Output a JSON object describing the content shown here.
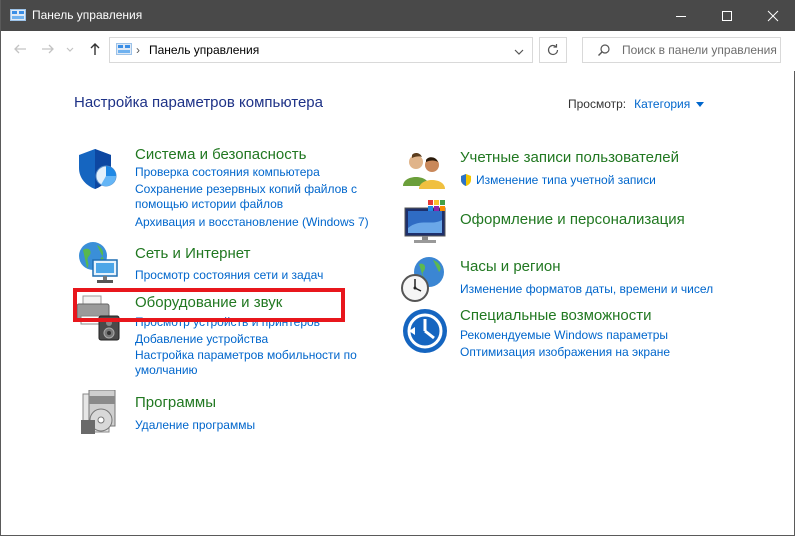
{
  "window": {
    "title": "Панель управления"
  },
  "address": {
    "path": "Панель управления"
  },
  "search": {
    "placeholder": "Поиск в панели управления"
  },
  "main": {
    "heading": "Настройка параметров компьютера",
    "view_label": "Просмотр:",
    "view_value": "Категория"
  },
  "categories": {
    "system": {
      "title": "Система и безопасность",
      "links": [
        "Проверка состояния компьютера",
        "Сохранение резервных копий файлов с",
        "помощью истории файлов",
        "Архивация и восстановление (Windows 7)"
      ]
    },
    "network": {
      "title": "Сеть и Интернет",
      "links": [
        "Просмотр состояния сети и задач"
      ]
    },
    "hardware": {
      "title": "Оборудование и звук",
      "links": [
        "Просмотр устройств и принтеров",
        "Добавление устройства",
        "Настройка параметров мобильности по",
        "умолчанию"
      ]
    },
    "programs": {
      "title": "Программы",
      "links": [
        "Удаление программы"
      ]
    },
    "accounts": {
      "title": "Учетные записи пользователей",
      "links": [
        "Изменение типа учетной записи"
      ]
    },
    "appearance": {
      "title": "Оформление и персонализация",
      "links": []
    },
    "clock": {
      "title": "Часы и регион",
      "links": [
        "Изменение форматов даты, времени и чисел"
      ]
    },
    "ease": {
      "title": "Специальные возможности",
      "links": [
        "Рекомендуемые Windows параметры",
        "Оптимизация изображения на экране"
      ]
    }
  },
  "colors": {
    "titlebar": "#494949",
    "heading": "#1e3287",
    "category_title": "#217821",
    "link": "#0066cc",
    "highlight": "#e8161c"
  }
}
